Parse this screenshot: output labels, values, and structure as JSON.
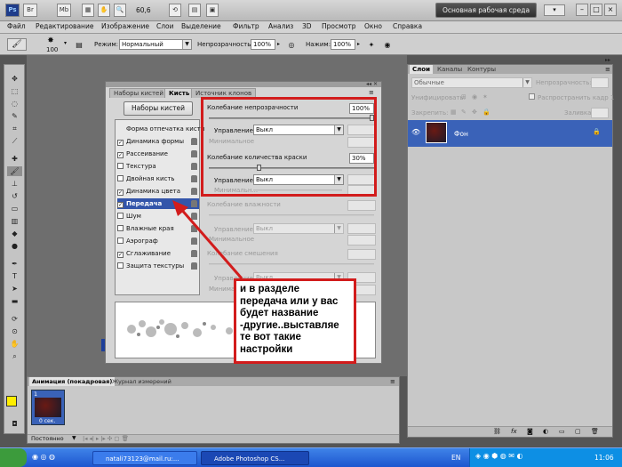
{
  "app_bar": {
    "zoom": "60,6",
    "workspace": "Основная рабочая среда",
    "ps_label": "Ps",
    "br_label": "Br",
    "mb_label": "Mb"
  },
  "menu": [
    "Файл",
    "Редактирование",
    "Изображение",
    "Слои",
    "Выделение",
    "Фильтр",
    "Анализ",
    "3D",
    "Просмотр",
    "Окно",
    "Справка"
  ],
  "options_bar": {
    "brush_size": "100",
    "mode_label": "Режим:",
    "mode_value": "Нормальный",
    "opacity_label": "Непрозрачность:",
    "opacity_value": "100%",
    "pressure_label": "Нажим:",
    "pressure_value": "100%"
  },
  "brush_panel": {
    "tabs": [
      "Наборы кистей",
      "Кисть",
      "Источник клонов"
    ],
    "presets_button": "Наборы кистей",
    "list": [
      {
        "label": "Форма отпечатка кисти",
        "checkbox": false,
        "checked": false,
        "selected": false
      },
      {
        "label": "Динамика формы",
        "checkbox": true,
        "checked": true,
        "selected": false
      },
      {
        "label": "Рассеивание",
        "checkbox": true,
        "checked": true,
        "selected": false
      },
      {
        "label": "Текстура",
        "checkbox": true,
        "checked": false,
        "selected": false
      },
      {
        "label": "Двойная кисть",
        "checkbox": true,
        "checked": false,
        "selected": false
      },
      {
        "label": "Динамика цвета",
        "checkbox": true,
        "checked": true,
        "selected": false
      },
      {
        "label": "Передача",
        "checkbox": true,
        "checked": true,
        "selected": true
      },
      {
        "label": "Шум",
        "checkbox": true,
        "checked": false,
        "selected": false
      },
      {
        "label": "Влажные края",
        "checkbox": true,
        "checked": false,
        "selected": false
      },
      {
        "label": "Аэрограф",
        "checkbox": true,
        "checked": false,
        "selected": false
      },
      {
        "label": "Сглаживание",
        "checkbox": true,
        "checked": true,
        "selected": false
      },
      {
        "label": "Защита текстуры",
        "checkbox": true,
        "checked": false,
        "selected": false
      }
    ],
    "opacity_jitter_label": "Колебание непрозрачности",
    "opacity_jitter_value": "100%",
    "control_label": "Управление:",
    "control_value": "Выкл",
    "minimum_label": "Минимальное",
    "flow_jitter_label": "Колебание количества краски",
    "flow_jitter_value": "30%",
    "control2_value": "Выкл",
    "minimum2_label": "Минимальн...",
    "wet_label": "Колебание влажности",
    "mix_label": "Колебание смешения",
    "dim_control_value": "Выкл",
    "dim_minimum_label": "Минимальное"
  },
  "annotation": {
    "text": "и в разделе\nпередача или у вас\nбудет название\n-другие..выставляе\nте вот такие\nнастройки"
  },
  "layers_panel": {
    "tabs": [
      "Слои",
      "Каналы",
      "Контуры"
    ],
    "blend_mode": "Обычные",
    "opacity_label": "Непрозрачность:",
    "unify_label": "Унифицировать:",
    "propagate_label": "Распространить кадр 1",
    "lock_label": "Закрепить:",
    "fill_label": "Заливка:",
    "layer_name": "Фон"
  },
  "animation_panel": {
    "tabs": [
      "Анимация (покадровая)",
      "Журнал измерений"
    ],
    "frame_number": "1",
    "frame_time": "0 сек.",
    "loop_value": "Постоянно"
  },
  "taskbar": {
    "start_label": "",
    "tasks": [
      "natali73123@mail.ru:...",
      "Adobe Photoshop CS..."
    ],
    "lang": "EN",
    "time": "11:06"
  },
  "colors": {
    "accent_red": "#d21c1c",
    "selection_blue": "#3355aa",
    "layer_blue": "#3a62b8",
    "taskbar_blue": "#2463d8",
    "foreground_color": "#ffee00",
    "background_color": "#ffffff"
  }
}
